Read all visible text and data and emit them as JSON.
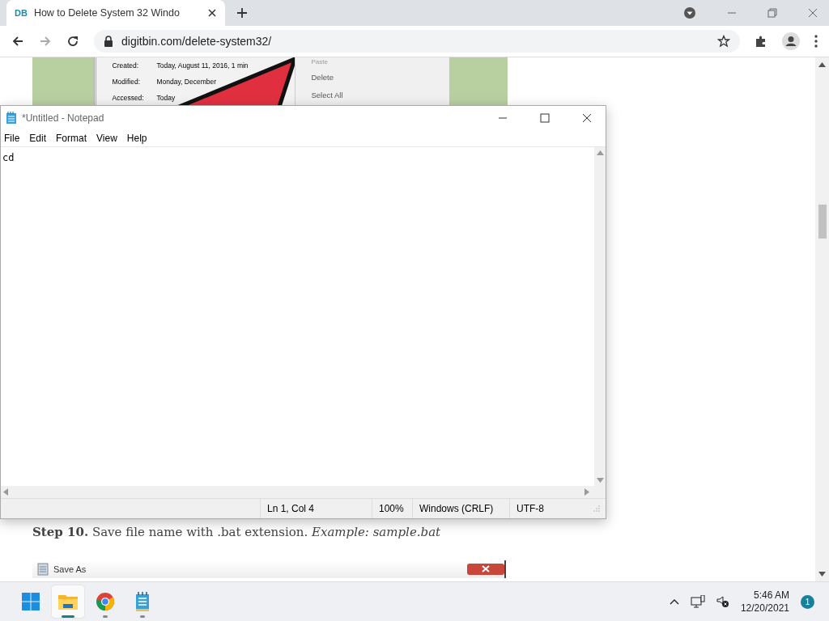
{
  "browser": {
    "tab": {
      "favicon": "DB",
      "title": "How to Delete System 32 Windo"
    },
    "url": "digitbin.com/delete-system32/"
  },
  "page": {
    "top_image": {
      "properties": [
        {
          "label": "Created:",
          "value": "Today, August 11, 2016, 1 min"
        },
        {
          "label": "Modified:",
          "value": "Monday, December"
        },
        {
          "label": "Accessed:",
          "value": "Today"
        }
      ],
      "menu": [
        "Paste",
        "Delete",
        "Select All"
      ]
    },
    "step": "**Step 10.** Save file name with .bat extension. *Example: sample.bat*",
    "save_as_image": {
      "title": "Save As"
    }
  },
  "notepad": {
    "title": "*Untitled - Notepad",
    "menu": [
      "File",
      "Edit",
      "Format",
      "View",
      "Help"
    ],
    "content": "cd",
    "status": [
      "Ln 1, Col 4",
      "100%",
      "Windows (CRLF)",
      "UTF-8"
    ]
  },
  "taskbar": {
    "apps": [
      {
        "kind": "start",
        "selected": false
      },
      {
        "kind": "explorer",
        "selected": true
      },
      {
        "kind": "chrome",
        "selected": false
      },
      {
        "kind": "notepad",
        "selected": false
      }
    ],
    "time": "5:46 AM",
    "date": "12/20/2021",
    "notifications": "1"
  }
}
